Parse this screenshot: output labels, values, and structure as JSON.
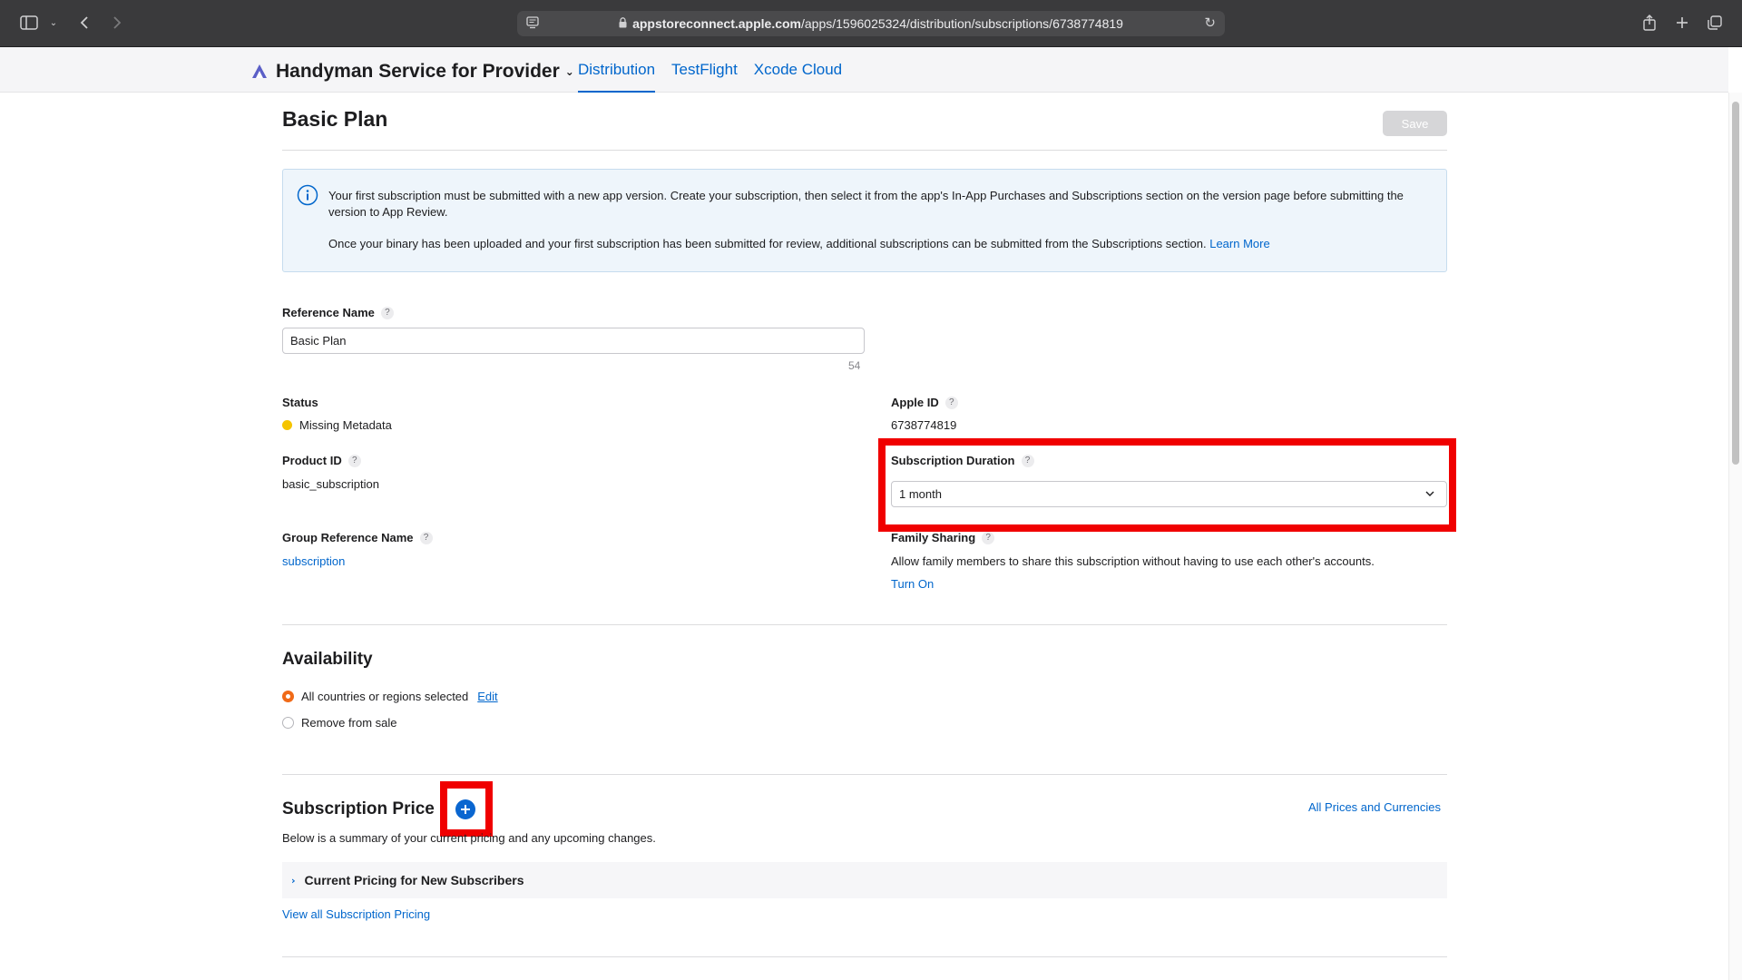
{
  "browser": {
    "url_host": "appstoreconnect.apple.com",
    "url_path": "/apps/1596025324/distribution/subscriptions/6738774819",
    "icons": [
      "sidebar-icon",
      "chevron-down-icon",
      "back-arrow-icon",
      "forward-arrow-icon",
      "site-settings-icon",
      "lock-icon",
      "reload-icon",
      "share-icon",
      "new-tab-icon",
      "tab-overview-icon"
    ]
  },
  "header": {
    "app_name": "Handyman Service for Provider",
    "tabs": [
      {
        "label": "Distribution",
        "active": true
      },
      {
        "label": "TestFlight",
        "active": false
      },
      {
        "label": "Xcode Cloud",
        "active": false
      }
    ]
  },
  "page": {
    "title": "Basic Plan",
    "save_label": "Save"
  },
  "info": {
    "line1": "Your first subscription must be submitted with a new app version. Create your subscription, then select it from the app's In-App Purchases and Subscriptions section on the version page before submitting the version to App Review.",
    "line2": "Once your binary has been uploaded and your first subscription has been submitted for review, additional subscriptions can be submitted from the Subscriptions section.",
    "learn_more": "Learn More"
  },
  "form": {
    "reference_name_label": "Reference Name",
    "reference_name_value": "Basic Plan",
    "reference_name_remaining": "54",
    "status_label": "Status",
    "status_value": "Missing Metadata",
    "status_color": "#f5c400",
    "apple_id_label": "Apple ID",
    "apple_id_value": "6738774819",
    "product_id_label": "Product ID",
    "product_id_value": "basic_subscription",
    "duration_label": "Subscription Duration",
    "duration_value": "1 month",
    "group_ref_label": "Group Reference Name",
    "group_ref_value": "subscription",
    "family_label": "Family Sharing",
    "family_desc": "Allow family members to share this subscription without having to use each other's accounts.",
    "family_action": "Turn On"
  },
  "availability": {
    "title": "Availability",
    "option_all": "All countries or regions selected",
    "edit": "Edit",
    "option_remove": "Remove from sale"
  },
  "pricing": {
    "title": "Subscription Price",
    "all_prices_link": "All Prices and Currencies",
    "summary": "Below is a summary of your current pricing and any upcoming changes.",
    "current_pricing": "Current Pricing for New Subscribers",
    "view_all": "View all Subscription Pricing"
  },
  "colors": {
    "accent": "#0066cc",
    "highlight": "#f00000",
    "radio_selected": "#f06a18"
  }
}
